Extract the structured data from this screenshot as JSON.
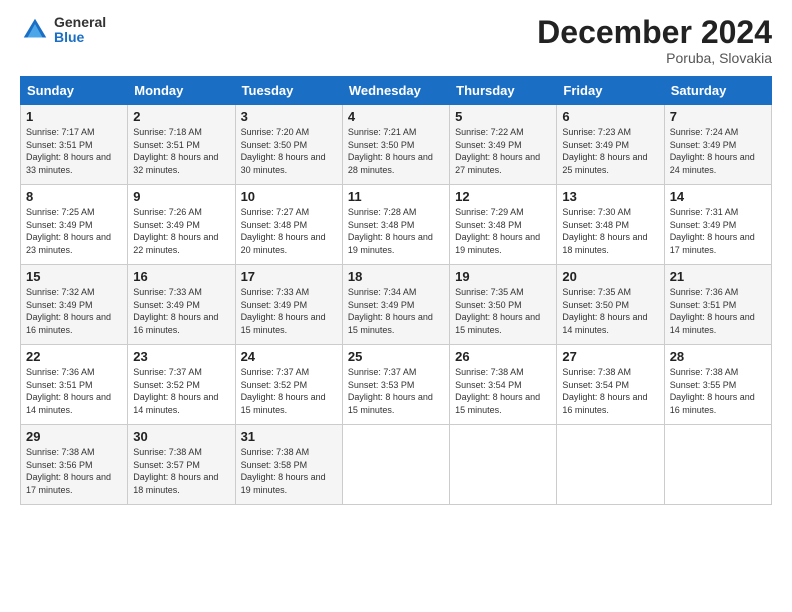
{
  "logo": {
    "general": "General",
    "blue": "Blue"
  },
  "title": "December 2024",
  "location": "Poruba, Slovakia",
  "days_of_week": [
    "Sunday",
    "Monday",
    "Tuesday",
    "Wednesday",
    "Thursday",
    "Friday",
    "Saturday"
  ],
  "weeks": [
    [
      {
        "day": "1",
        "sunrise": "7:17 AM",
        "sunset": "3:51 PM",
        "daylight": "8 hours and 33 minutes."
      },
      {
        "day": "2",
        "sunrise": "7:18 AM",
        "sunset": "3:51 PM",
        "daylight": "8 hours and 32 minutes."
      },
      {
        "day": "3",
        "sunrise": "7:20 AM",
        "sunset": "3:50 PM",
        "daylight": "8 hours and 30 minutes."
      },
      {
        "day": "4",
        "sunrise": "7:21 AM",
        "sunset": "3:50 PM",
        "daylight": "8 hours and 28 minutes."
      },
      {
        "day": "5",
        "sunrise": "7:22 AM",
        "sunset": "3:49 PM",
        "daylight": "8 hours and 27 minutes."
      },
      {
        "day": "6",
        "sunrise": "7:23 AM",
        "sunset": "3:49 PM",
        "daylight": "8 hours and 25 minutes."
      },
      {
        "day": "7",
        "sunrise": "7:24 AM",
        "sunset": "3:49 PM",
        "daylight": "8 hours and 24 minutes."
      }
    ],
    [
      {
        "day": "8",
        "sunrise": "7:25 AM",
        "sunset": "3:49 PM",
        "daylight": "8 hours and 23 minutes."
      },
      {
        "day": "9",
        "sunrise": "7:26 AM",
        "sunset": "3:49 PM",
        "daylight": "8 hours and 22 minutes."
      },
      {
        "day": "10",
        "sunrise": "7:27 AM",
        "sunset": "3:48 PM",
        "daylight": "8 hours and 20 minutes."
      },
      {
        "day": "11",
        "sunrise": "7:28 AM",
        "sunset": "3:48 PM",
        "daylight": "8 hours and 19 minutes."
      },
      {
        "day": "12",
        "sunrise": "7:29 AM",
        "sunset": "3:48 PM",
        "daylight": "8 hours and 19 minutes."
      },
      {
        "day": "13",
        "sunrise": "7:30 AM",
        "sunset": "3:48 PM",
        "daylight": "8 hours and 18 minutes."
      },
      {
        "day": "14",
        "sunrise": "7:31 AM",
        "sunset": "3:49 PM",
        "daylight": "8 hours and 17 minutes."
      }
    ],
    [
      {
        "day": "15",
        "sunrise": "7:32 AM",
        "sunset": "3:49 PM",
        "daylight": "8 hours and 16 minutes."
      },
      {
        "day": "16",
        "sunrise": "7:33 AM",
        "sunset": "3:49 PM",
        "daylight": "8 hours and 16 minutes."
      },
      {
        "day": "17",
        "sunrise": "7:33 AM",
        "sunset": "3:49 PM",
        "daylight": "8 hours and 15 minutes."
      },
      {
        "day": "18",
        "sunrise": "7:34 AM",
        "sunset": "3:49 PM",
        "daylight": "8 hours and 15 minutes."
      },
      {
        "day": "19",
        "sunrise": "7:35 AM",
        "sunset": "3:50 PM",
        "daylight": "8 hours and 15 minutes."
      },
      {
        "day": "20",
        "sunrise": "7:35 AM",
        "sunset": "3:50 PM",
        "daylight": "8 hours and 14 minutes."
      },
      {
        "day": "21",
        "sunrise": "7:36 AM",
        "sunset": "3:51 PM",
        "daylight": "8 hours and 14 minutes."
      }
    ],
    [
      {
        "day": "22",
        "sunrise": "7:36 AM",
        "sunset": "3:51 PM",
        "daylight": "8 hours and 14 minutes."
      },
      {
        "day": "23",
        "sunrise": "7:37 AM",
        "sunset": "3:52 PM",
        "daylight": "8 hours and 14 minutes."
      },
      {
        "day": "24",
        "sunrise": "7:37 AM",
        "sunset": "3:52 PM",
        "daylight": "8 hours and 15 minutes."
      },
      {
        "day": "25",
        "sunrise": "7:37 AM",
        "sunset": "3:53 PM",
        "daylight": "8 hours and 15 minutes."
      },
      {
        "day": "26",
        "sunrise": "7:38 AM",
        "sunset": "3:54 PM",
        "daylight": "8 hours and 15 minutes."
      },
      {
        "day": "27",
        "sunrise": "7:38 AM",
        "sunset": "3:54 PM",
        "daylight": "8 hours and 16 minutes."
      },
      {
        "day": "28",
        "sunrise": "7:38 AM",
        "sunset": "3:55 PM",
        "daylight": "8 hours and 16 minutes."
      }
    ],
    [
      {
        "day": "29",
        "sunrise": "7:38 AM",
        "sunset": "3:56 PM",
        "daylight": "8 hours and 17 minutes."
      },
      {
        "day": "30",
        "sunrise": "7:38 AM",
        "sunset": "3:57 PM",
        "daylight": "8 hours and 18 minutes."
      },
      {
        "day": "31",
        "sunrise": "7:38 AM",
        "sunset": "3:58 PM",
        "daylight": "8 hours and 19 minutes."
      },
      null,
      null,
      null,
      null
    ]
  ]
}
